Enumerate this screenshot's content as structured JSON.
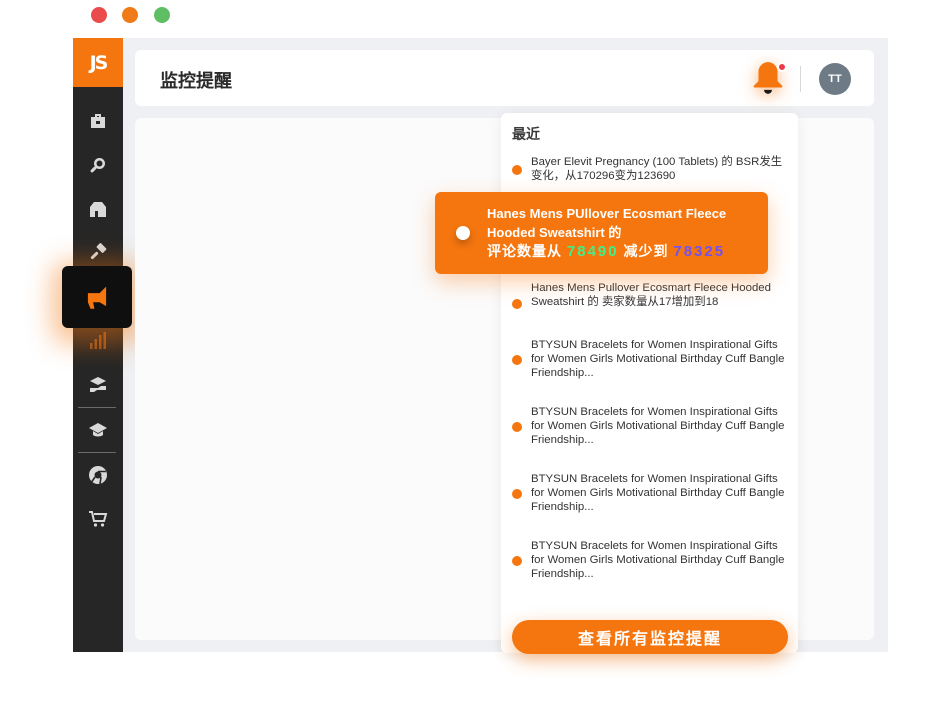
{
  "window": {
    "controls": [
      "close",
      "minimize",
      "maximize"
    ]
  },
  "brand": {
    "logo_text": "JS",
    "accent_color": "#f5760f",
    "sidebar_color": "#262626"
  },
  "sidebar": {
    "items": [
      {
        "icon": "toolbox-icon",
        "active": false
      },
      {
        "icon": "search-magnifier-icon",
        "active": false
      },
      {
        "icon": "store-icon",
        "active": false
      },
      {
        "icon": "hammer-icon",
        "active": false
      },
      {
        "icon": "megaphone-icon",
        "active": true
      },
      {
        "icon": "bar-chart-icon",
        "active": false
      },
      {
        "icon": "hand-cap-icon",
        "active": false
      },
      {
        "icon": "graduation-cap-icon",
        "active": false
      },
      {
        "icon": "chrome-icon",
        "active": false
      },
      {
        "icon": "cart-icon",
        "active": false
      }
    ]
  },
  "header": {
    "title": "监控提醒",
    "bell_icon": "bell-icon",
    "has_unread": true,
    "avatar_initials": "TT"
  },
  "notifications": {
    "title": "最近",
    "items": [
      {
        "text": "Bayer Elevit Pregnancy (100 Tablets) 的 BSR发生变化，从170296变为123690"
      },
      {
        "text": "Hanes Mens Pullover Ecosmart Fleece Hooded Sweatshirt 的 卖家数量从17增加到18"
      },
      {
        "text": "BTYSUN Bracelets for Women Inspirational Gifts for Women Girls Motivational Birthday Cuff Bangle Friendship..."
      },
      {
        "text": "BTYSUN Bracelets for Women Inspirational Gifts for Women Girls Motivational Birthday Cuff Bangle Friendship..."
      },
      {
        "text": "BTYSUN Bracelets for Women Inspirational Gifts for Women Girls Motivational Birthday Cuff Bangle Friendship..."
      },
      {
        "text": "BTYSUN Bracelets for Women Inspirational Gifts for Women Girls Motivational Birthday Cuff Bangle Friendship..."
      }
    ],
    "view_all_label": "查看所有监控提醒"
  },
  "toast": {
    "line1": "Hanes Mens PUllover Ecosmart Fleece",
    "line2": "Hooded Sweatshirt 的",
    "prefix": "评论数量从",
    "old_value": "78490",
    "middle": "减少到",
    "new_value": "78325"
  }
}
